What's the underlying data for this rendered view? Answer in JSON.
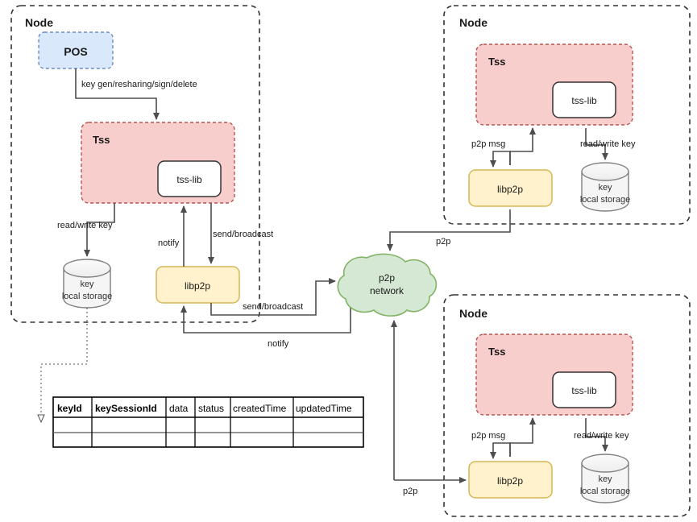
{
  "diagram": {
    "title": "TSS node p2p architecture",
    "colors": {
      "pos_fill": "#dae8fc",
      "pos_stroke": "#6c8ebf",
      "tss_fill": "#f8cecc",
      "tss_stroke": "#b85450",
      "libp2p_fill": "#fff2cc",
      "libp2p_stroke": "#d6b656",
      "cloud_fill": "#d5e8d4",
      "cloud_stroke": "#82b366",
      "storage_fill": "#f5f5f5",
      "storage_stroke": "#808080",
      "node_stroke": "#333333",
      "edge_stroke": "#4d4d4d",
      "table_stroke": "#000000",
      "tss_lib_fill": "#ffffff",
      "tss_lib_stroke": "#333333"
    }
  },
  "nodes": {
    "left": {
      "title": "Node",
      "pos": {
        "label": "POS"
      },
      "tss": {
        "title": "Tss",
        "lib_label": "tss-lib"
      },
      "libp2p": {
        "label": "libp2p"
      },
      "storage": {
        "line1": "key",
        "line2": "local storage"
      },
      "edges": {
        "pos_to_tss": "key gen/resharing/sign/delete",
        "tss_to_storage": "read/write key",
        "libp2p_to_tss_notify": "notify",
        "tss_to_libp2p_send": "send/broadcast",
        "libp2p_to_cloud_send": "send/broadcast",
        "cloud_to_libp2p_notify": "notify"
      }
    },
    "top_right": {
      "title": "Node",
      "tss": {
        "title": "Tss",
        "lib_label": "tss-lib"
      },
      "libp2p": {
        "label": "libp2p"
      },
      "storage": {
        "line1": "key",
        "line2": "local storage"
      },
      "edges": {
        "p2p_msg": "p2p msg",
        "read_write_key": "read/write key",
        "p2p": "p2p"
      }
    },
    "bottom_right": {
      "title": "Node",
      "tss": {
        "title": "Tss",
        "lib_label": "tss-lib"
      },
      "libp2p": {
        "label": "libp2p"
      },
      "storage": {
        "line1": "key",
        "line2": "local storage"
      },
      "edges": {
        "p2p_msg": "p2p msg",
        "read_write_key": "read/write key",
        "p2p": "p2p"
      }
    }
  },
  "cloud": {
    "line1": "p2p",
    "line2": "network"
  },
  "table": {
    "headers": [
      {
        "text": "keyId",
        "bold": true
      },
      {
        "text": "keySessionId",
        "bold": true
      },
      {
        "text": "data",
        "bold": false
      },
      {
        "text": "status",
        "bold": false
      },
      {
        "text": "createdTime",
        "bold": false
      },
      {
        "text": "updatedTime",
        "bold": false
      }
    ],
    "rows": [
      [
        "",
        "",
        "",
        "",
        "",
        ""
      ],
      [
        "",
        "",
        "",
        "",
        "",
        ""
      ]
    ]
  }
}
